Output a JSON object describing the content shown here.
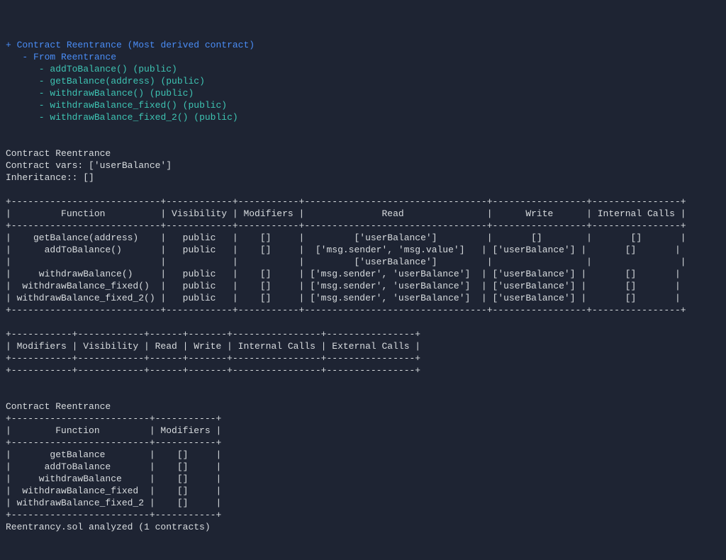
{
  "tree": {
    "root_plus": "+ ",
    "root_name": "Contract Reentrance",
    "root_suffix": " (Most derived contract)",
    "from_dash": "   - ",
    "from_label": "From Reentrance",
    "fn_prefix": "      - ",
    "fns": [
      {
        "name": "addToBalance()",
        "vis": " (public)"
      },
      {
        "name": "getBalance(address)",
        "vis": " (public)"
      },
      {
        "name": "withdrawBalance()",
        "vis": " (public)"
      },
      {
        "name": "withdrawBalance_fixed()",
        "vis": " (public)"
      },
      {
        "name": "withdrawBalance_fixed_2()",
        "vis": " (public)"
      }
    ]
  },
  "blank": "",
  "summary": {
    "title": "Contract Reentrance",
    "vars": "Contract vars: ['userBalance']",
    "inh": "Inheritance:: []"
  },
  "table1": {
    "border_top": "+---------------------------+------------+-----------+---------------------------------+-----------------+----------------+",
    "header": "|         Function          | Visibility | Modifiers |              Read               |      Write      | Internal Calls |",
    "border_mid": "+---------------------------+------------+-----------+---------------------------------+-----------------+----------------+",
    "rows": [
      "|    getBalance(address)    |   public   |    []     |         ['userBalance']         |       []        |       []       |",
      "|      addToBalance()       |   public   |    []     |  ['msg.sender', 'msg.value']   | ['userBalance'] |       []       |",
      "|                           |            |           |         ['userBalance']         |                 |                |",
      "|     withdrawBalance()     |   public   |    []     | ['msg.sender', 'userBalance']  | ['userBalance'] |       []       |",
      "|  withdrawBalance_fixed()  |   public   |    []     | ['msg.sender', 'userBalance']  | ['userBalance'] |       []       |",
      "| withdrawBalance_fixed_2() |   public   |    []     | ['msg.sender', 'userBalance']  | ['userBalance'] |       []       |"
    ],
    "border_bot": "+---------------------------+------------+-----------+---------------------------------+-----------------+----------------+"
  },
  "table2": {
    "border_top": "+-----------+------------+------+-------+----------------+----------------+",
    "header": "| Modifiers | Visibility | Read | Write | Internal Calls | External Calls |",
    "border_mid": "+-----------+------------+------+-------+----------------+----------------+",
    "border_bot": "+-----------+------------+------+-------+----------------+----------------+"
  },
  "summary2": {
    "title": "Contract Reentrance"
  },
  "table3": {
    "border_top": "+-------------------------+-----------+",
    "header": "|        Function         | Modifiers |",
    "border_mid": "+-------------------------+-----------+",
    "rows": [
      "|       getBalance        |    []     |",
      "|      addToBalance       |    []     |",
      "|     withdrawBalance     |    []     |",
      "|  withdrawBalance_fixed  |    []     |",
      "| withdrawBalance_fixed_2 |    []     |"
    ],
    "border_bot": "+-------------------------+-----------+"
  },
  "footer": "Reentrancy.sol analyzed (1 contracts)",
  "chart_data": {
    "type": "table",
    "contract": "Reentrance",
    "vars": [
      "userBalance"
    ],
    "inheritance": [],
    "functions_detail": [
      {
        "function": "getBalance(address)",
        "visibility": "public",
        "modifiers": [],
        "read": [
          "userBalance"
        ],
        "write": [],
        "internal_calls": []
      },
      {
        "function": "addToBalance()",
        "visibility": "public",
        "modifiers": [],
        "read": [
          "msg.sender",
          "msg.value",
          "userBalance"
        ],
        "write": [
          "userBalance"
        ],
        "internal_calls": []
      },
      {
        "function": "withdrawBalance()",
        "visibility": "public",
        "modifiers": [],
        "read": [
          "msg.sender",
          "userBalance"
        ],
        "write": [
          "userBalance"
        ],
        "internal_calls": []
      },
      {
        "function": "withdrawBalance_fixed()",
        "visibility": "public",
        "modifiers": [],
        "read": [
          "msg.sender",
          "userBalance"
        ],
        "write": [
          "userBalance"
        ],
        "internal_calls": []
      },
      {
        "function": "withdrawBalance_fixed_2()",
        "visibility": "public",
        "modifiers": [],
        "read": [
          "msg.sender",
          "userBalance"
        ],
        "write": [
          "userBalance"
        ],
        "internal_calls": []
      }
    ],
    "modifier_table_columns": [
      "Modifiers",
      "Visibility",
      "Read",
      "Write",
      "Internal Calls",
      "External Calls"
    ],
    "functions_modifiers": [
      {
        "function": "getBalance",
        "modifiers": []
      },
      {
        "function": "addToBalance",
        "modifiers": []
      },
      {
        "function": "withdrawBalance",
        "modifiers": []
      },
      {
        "function": "withdrawBalance_fixed",
        "modifiers": []
      },
      {
        "function": "withdrawBalance_fixed_2",
        "modifiers": []
      }
    ],
    "analyzed_file": "Reentrancy.sol",
    "contracts_count": 1
  }
}
